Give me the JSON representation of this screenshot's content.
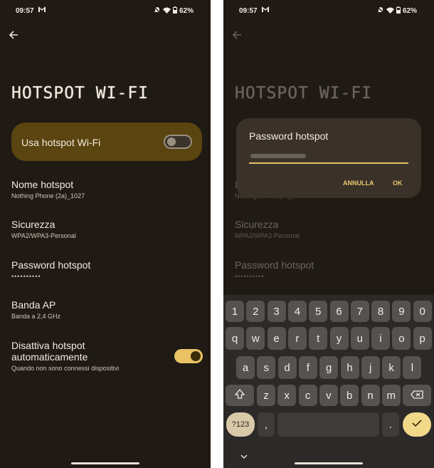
{
  "status_bar": {
    "time": "09:57",
    "battery": "62%"
  },
  "settings": {
    "title": "HOTSPOT WI-FI",
    "use_hotspot_label": "Usa hotspot Wi-Fi",
    "use_hotspot_on": false,
    "items": [
      {
        "title": "Nome hotspot",
        "subtitle": "Nothing Phone (2a)_1027"
      },
      {
        "title": "Sicurezza",
        "subtitle": "WPA2/WPA3-Personal"
      },
      {
        "title": "Password hotspot",
        "subtitle": "••••••••••"
      },
      {
        "title": "Banda AP",
        "subtitle": "Banda a 2,4 GHz"
      },
      {
        "title": "Disattiva hotspot automaticamente",
        "title_line1": "Disattiva hotspot",
        "title_line2": "automaticamente",
        "subtitle": "Quando non sono connessi dispositivi"
      }
    ],
    "auto_off_on": true
  },
  "dialog": {
    "title": "Password hotspot",
    "cancel_label": "ANNULLA",
    "ok_label": "OK"
  },
  "keyboard": {
    "row1": [
      "1",
      "2",
      "3",
      "4",
      "5",
      "6",
      "7",
      "8",
      "9",
      "0"
    ],
    "row2": [
      "q",
      "w",
      "e",
      "r",
      "t",
      "y",
      "u",
      "i",
      "o",
      "p"
    ],
    "row3": [
      "a",
      "s",
      "d",
      "f",
      "g",
      "h",
      "j",
      "k",
      "l"
    ],
    "row4": [
      "z",
      "x",
      "c",
      "v",
      "b",
      "n",
      "m"
    ],
    "symbols_label": "?123",
    "comma": ",",
    "period": ".",
    "shift_icon": "shift-icon",
    "backspace_icon": "backspace-icon",
    "enter_icon": "check-icon"
  },
  "colors": {
    "background": "#1f1a14",
    "accent": "#e8c265",
    "card": "#5a4410"
  }
}
